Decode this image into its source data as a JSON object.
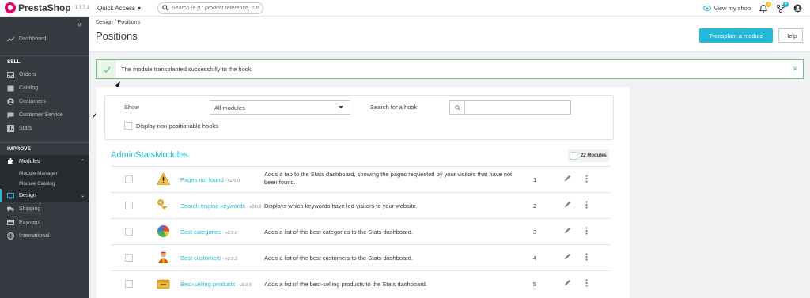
{
  "app": {
    "brand": "PrestaShop",
    "version": "1.7.7.1",
    "quick_access": "Quick Access",
    "search_placeholder": "Search (e.g.: product reference, custome",
    "view_shop": "View my shop",
    "notif_count_orders": "2",
    "notif_count_customers": "4"
  },
  "sidebar": {
    "dashboard": "Dashboard",
    "sell_section": "SELL",
    "orders": "Orders",
    "catalog": "Catalog",
    "customers": "Customers",
    "customer_service": "Customer Service",
    "stats": "Stats",
    "improve_section": "IMPROVE",
    "modules": "Modules",
    "module_manager": "Module Manager",
    "module_catalog": "Module Catalog",
    "design": "Design",
    "shipping": "Shipping",
    "payment": "Payment",
    "international": "International"
  },
  "header": {
    "breadcrumb_parent": "Design",
    "breadcrumb_current": "Positions",
    "title": "Positions",
    "transplant_button": "Transplant a module",
    "help_button": "Help"
  },
  "alert": {
    "message": "The module transplanted successfully to the hook."
  },
  "filters": {
    "show_label": "Show",
    "show_value": "All modules",
    "hook_label": "Search for a hook",
    "hook_value": "",
    "non_positionable_label": "Display non-positionable hooks"
  },
  "hook": {
    "name": "AdminStatsModules",
    "module_count": "22 Modules"
  },
  "modules": [
    {
      "name": "Pages not found",
      "version": "- v2.0.0",
      "description": "Adds a tab to the Stats dashboard, showing the pages requested by your visitors that have not been found.",
      "position": "1",
      "icon": "warning-icon"
    },
    {
      "name": "Search engine keywords",
      "version": "- v2.0.0",
      "description": "Displays which keywords have led visitors to your website.",
      "position": "2",
      "icon": "keys-icon"
    },
    {
      "name": "Best categories",
      "version": "- v2.0.0",
      "description": "Adds a list of the best categories to the Stats dashboard.",
      "position": "3",
      "icon": "pie-chart-icon"
    },
    {
      "name": "Best customers",
      "version": "- v2.0.2",
      "description": "Adds a list of the best customers to the Stats dashboard.",
      "position": "4",
      "icon": "customer-icon"
    },
    {
      "name": "Best-selling products",
      "version": "- v2.0.0",
      "description": "Adds a list of the best-selling products to the Stats dashboard.",
      "position": "5",
      "icon": "box-icon"
    }
  ],
  "colors": {
    "accent": "#25b9d7",
    "success": "#72c279",
    "sidebar": "#363a41"
  }
}
